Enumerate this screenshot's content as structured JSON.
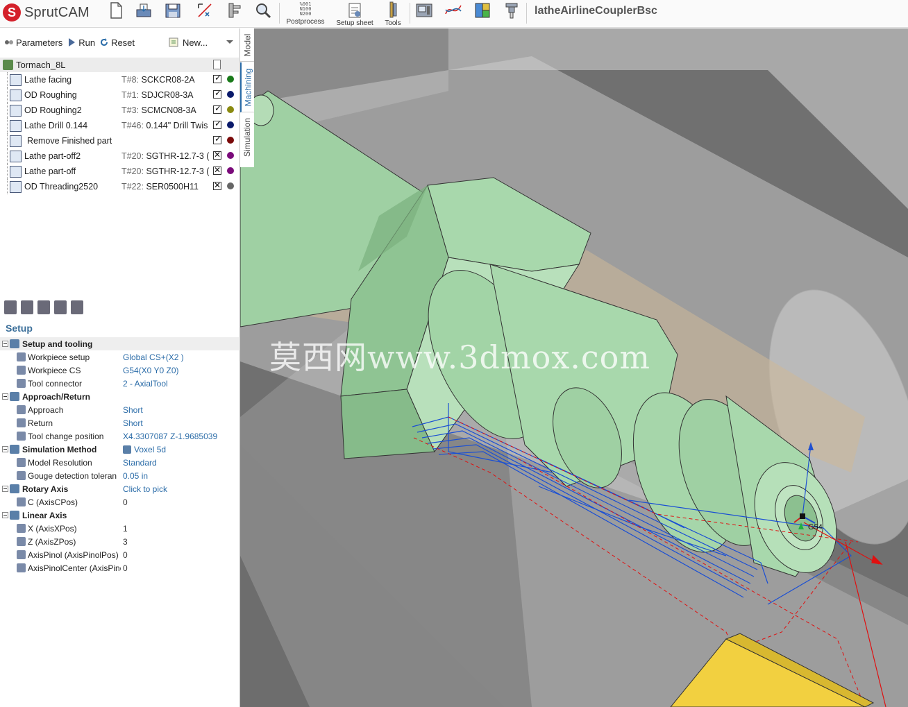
{
  "app": {
    "name": "SprutCAM",
    "logo_letter": "S",
    "project_title": "latheAirlineCouplerBsc"
  },
  "toolbar": {
    "buttons": [
      {
        "id": "new",
        "label": "",
        "icon": "new-document-icon"
      },
      {
        "id": "open",
        "label": "",
        "icon": "open-icon"
      },
      {
        "id": "save",
        "label": "",
        "icon": "save-icon"
      },
      {
        "id": "transform",
        "label": "",
        "icon": "transform-icon"
      },
      {
        "id": "measure",
        "label": "",
        "icon": "caliper-icon"
      },
      {
        "id": "zoom",
        "label": "",
        "icon": "zoom-icon"
      },
      {
        "id": "postprocess",
        "label": "Postprocess",
        "icon": "postprocess-icon",
        "caption_lines": [
          "%001",
          "N100",
          "N200"
        ]
      },
      {
        "id": "setup-sheet",
        "label": "Setup sheet",
        "icon": "setup-sheet-icon"
      },
      {
        "id": "tools",
        "label": "Tools",
        "icon": "tools-icon"
      },
      {
        "id": "machine",
        "label": "",
        "icon": "machine-icon"
      },
      {
        "id": "curves",
        "label": "",
        "icon": "curves-icon"
      },
      {
        "id": "colors",
        "label": "",
        "icon": "colors-icon"
      },
      {
        "id": "tool-holder",
        "label": "",
        "icon": "tool-holder-icon"
      }
    ]
  },
  "op_toolbar": {
    "parameters": "Parameters",
    "run": "Run",
    "reset": "Reset",
    "new": "New..."
  },
  "tree": {
    "root": "Tormach_8L",
    "operations": [
      {
        "name": "Lathe facing",
        "tool_num": "T#8:",
        "tool": "SCKCR08-2A",
        "enabled": true,
        "color": "#1a7a1a"
      },
      {
        "name": "OD Roughing",
        "tool_num": "T#1:",
        "tool": "SDJCR08-3A",
        "enabled": true,
        "color": "#0a1a6a"
      },
      {
        "name": "OD Roughing2",
        "tool_num": "T#3:",
        "tool": "SCMCN08-3A",
        "enabled": true,
        "color": "#8a8a10"
      },
      {
        "name": "Lathe Drill 0.144",
        "tool_num": "T#46:",
        "tool": "0.144\" Drill Twis",
        "enabled": true,
        "color": "#0a1a6a"
      },
      {
        "name": "Remove Finished part",
        "tool_num": "",
        "tool": "",
        "enabled": true,
        "color": "#7a0a0a"
      },
      {
        "name": "Lathe part-off2",
        "tool_num": "T#20:",
        "tool": "SGTHR-12.7-3 (",
        "enabled": false,
        "color": "#7a0a7a"
      },
      {
        "name": "Lathe part-off",
        "tool_num": "T#20:",
        "tool": "SGTHR-12.7-3 (",
        "enabled": false,
        "color": "#7a0a7a"
      },
      {
        "name": "OD Threading2520",
        "tool_num": "T#22:",
        "tool": "SER0500H11",
        "enabled": false,
        "color": "#666666"
      }
    ]
  },
  "setup": {
    "title": "Setup",
    "groups": [
      {
        "name": "Setup and tooling",
        "items": [
          {
            "name": "Workpiece setup",
            "value": "Global CS+(X2 )"
          },
          {
            "name": "Workpiece CS",
            "value": "G54(X0 Y0 Z0)"
          },
          {
            "name": "Tool connector",
            "value": "2 - AxialTool"
          }
        ]
      },
      {
        "name": "Approach/Return",
        "items": [
          {
            "name": "Approach",
            "value": "Short"
          },
          {
            "name": "Return",
            "value": "Short"
          },
          {
            "name": "Tool change position",
            "value": "X4.3307087 Z-1.9685039"
          }
        ]
      },
      {
        "name": "Simulation Method",
        "value": "Voxel 5d",
        "items": [
          {
            "name": "Model Resolution",
            "value": "Standard"
          },
          {
            "name": "Gouge detection toleran",
            "value": "0.05 in"
          }
        ]
      },
      {
        "name": "Rotary Axis",
        "value": "Click to pick",
        "items": [
          {
            "name": "C (AxisCPos)",
            "value": "0"
          }
        ]
      },
      {
        "name": "Linear Axis",
        "items": [
          {
            "name": "X (AxisXPos)",
            "value": "1"
          },
          {
            "name": "Z (AxisZPos)",
            "value": "3"
          },
          {
            "name": "AxisPinol (AxisPinolPos)",
            "value": "0"
          },
          {
            "name": "AxisPinolCenter (AxisPinolCenterPos)",
            "value": "0"
          }
        ]
      }
    ]
  },
  "side_tabs": [
    "Model",
    "Machining",
    "Simulation"
  ],
  "viewport": {
    "watermark": "莫西网www.3dmox.com",
    "cs_label": "G54",
    "colors": {
      "part": "#a4d4a8",
      "stock": "#c8c8c8",
      "toolpath": "#1a4fd4",
      "rapid": "#e01010",
      "tool": "#f2d040"
    }
  }
}
